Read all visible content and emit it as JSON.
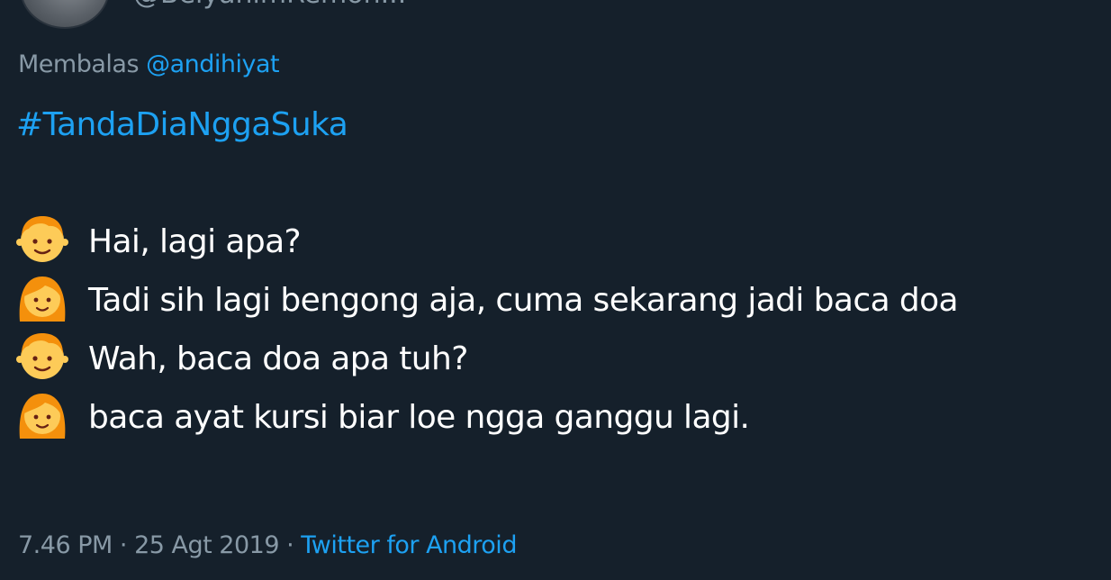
{
  "author": {
    "handle": "@BelyanimRemon..."
  },
  "reply": {
    "prefix": "Membalas",
    "mention": "@andihiyat"
  },
  "tweet": {
    "hashtag": "#TandaDiaNggaSuka",
    "lines": [
      {
        "speaker": "boy",
        "emoji_icon": "boy-emoji-icon",
        "text": "Hai, lagi apa?"
      },
      {
        "speaker": "girl",
        "emoji_icon": "girl-emoji-icon",
        "text": "Tadi sih lagi bengong aja, cuma sekarang jadi baca doa"
      },
      {
        "speaker": "boy",
        "emoji_icon": "boy-emoji-icon",
        "text": "Wah, baca doa apa tuh?"
      },
      {
        "speaker": "girl",
        "emoji_icon": "girl-emoji-icon",
        "text": "baca ayat kursi biar loe ngga ganggu lagi."
      }
    ]
  },
  "meta": {
    "time": "7.46 PM",
    "separator": "·",
    "date": "25 Agt 2019",
    "source": "Twitter for Android"
  },
  "colors": {
    "background": "#15202b",
    "text": "#ffffff",
    "secondary": "#8899a6",
    "link": "#1da1f2"
  }
}
